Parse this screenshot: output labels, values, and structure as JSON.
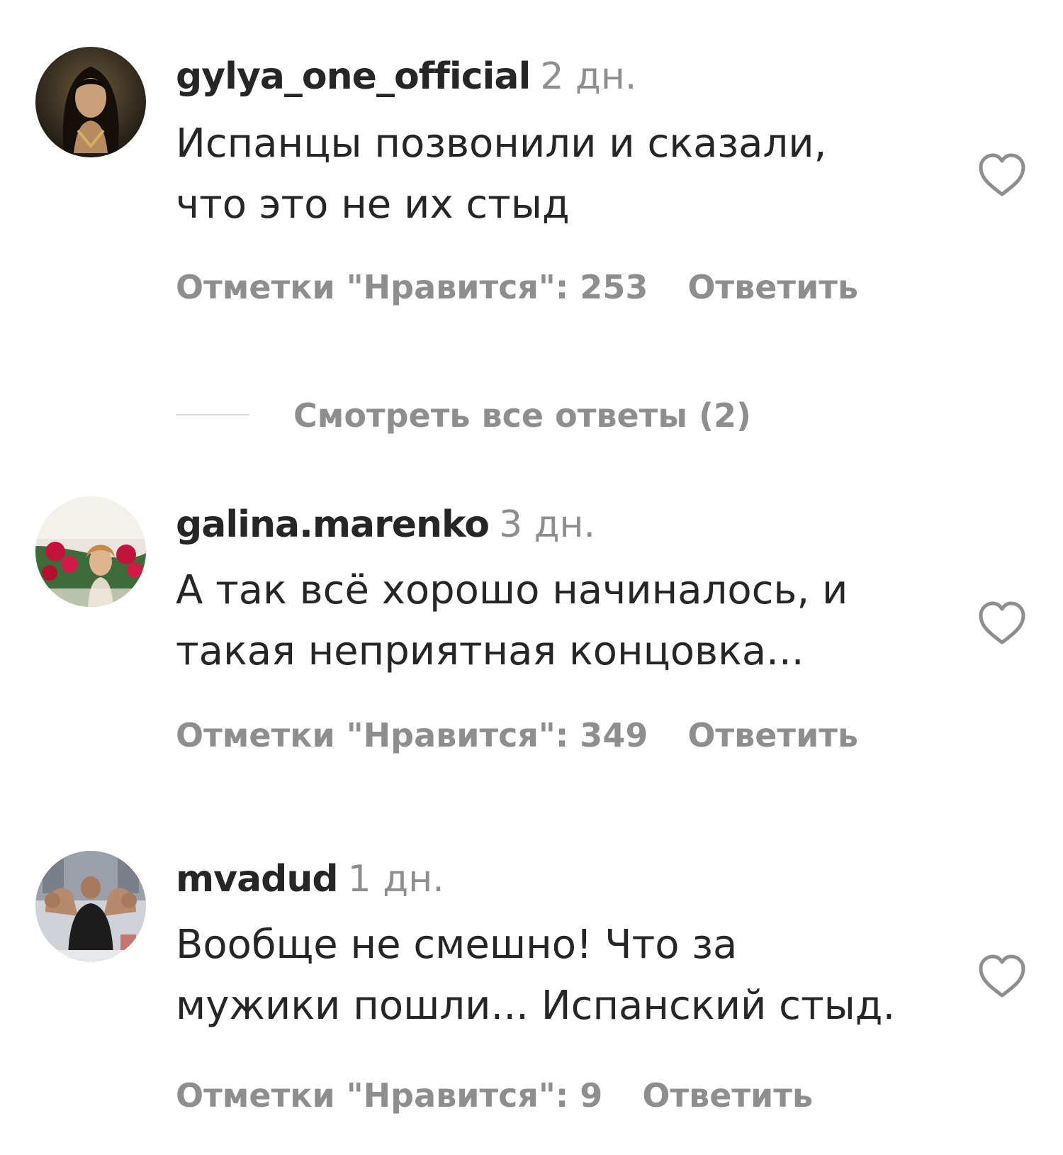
{
  "comments": [
    {
      "username": "gylya_one_official",
      "timestamp": "2 дн.",
      "text": "Испанцы позвонили и сказали,\nчто это не их стыд",
      "likes_label": "Отметки \"Нравится\": 253",
      "reply_label": "Ответить",
      "avatar_icon": "avatar-woman-dark-hair",
      "heart_icon": "heart-outline-icon",
      "view_replies_label": "Смотреть все ответы (2)"
    },
    {
      "username": "galina.marenko",
      "timestamp": "3 дн.",
      "text": "А так всё хорошо начиналось, и\nтакая неприятная концовка...",
      "likes_label": "Отметки \"Нравится\": 349",
      "reply_label": "Ответить",
      "avatar_icon": "avatar-woman-with-roses",
      "heart_icon": "heart-outline-icon"
    },
    {
      "username": "mvadud",
      "timestamp": "1 дн.",
      "text": "Вообще не смешно! Что за\nмужики пошли... Испанский стыд.",
      "likes_label": "Отметки \"Нравится\": 9",
      "reply_label": "Ответить",
      "avatar_icon": "avatar-man-flexing",
      "heart_icon": "heart-outline-icon"
    }
  ],
  "colors": {
    "primary_text": "#262626",
    "secondary_text": "#8e8e8e",
    "divider": "#dbdbdb",
    "background": "#ffffff"
  }
}
